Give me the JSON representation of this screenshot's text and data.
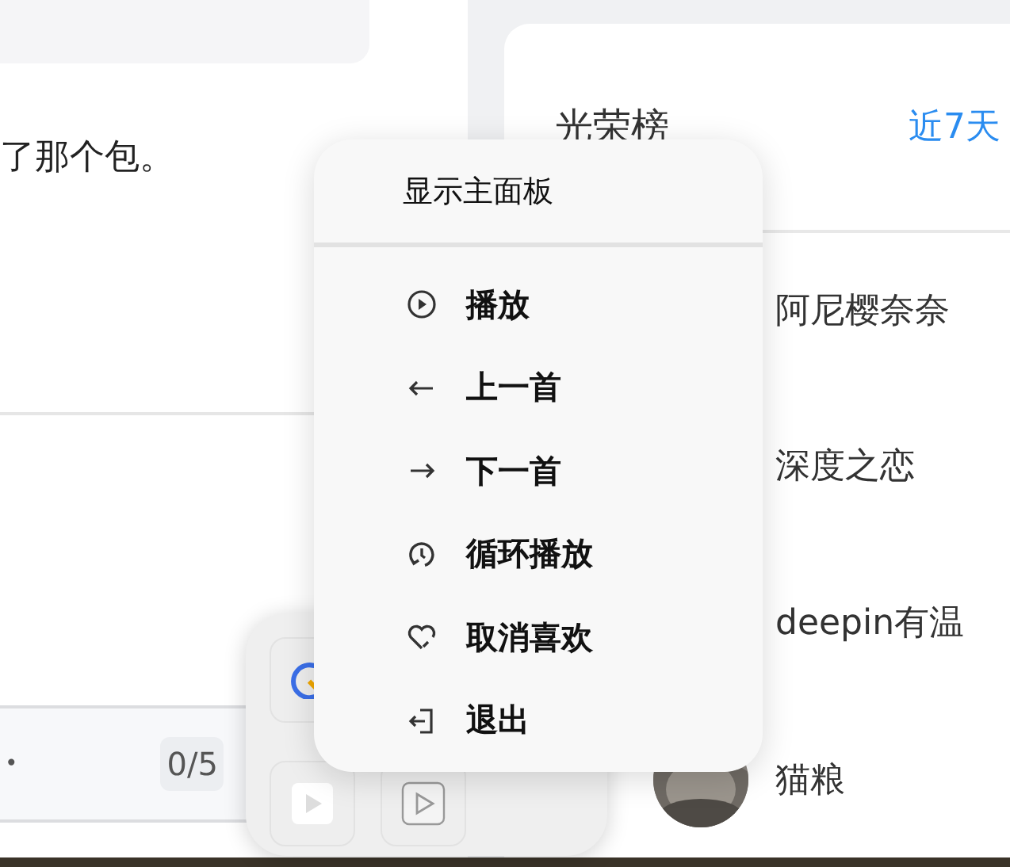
{
  "chat": {
    "message": "了那个包。",
    "input": {
      "dot": "•",
      "counter": "0/5"
    }
  },
  "leaderboard": {
    "title": "光荣榜",
    "range": "近7天",
    "entries": [
      {
        "name": "阿尼樱奈奈"
      },
      {
        "name": "深度之恋"
      },
      {
        "name": "deepin有温"
      },
      {
        "name": "猫粮"
      }
    ]
  },
  "tray_menu": {
    "header": "显示主面板",
    "items": [
      {
        "label": "播放",
        "kind": "play"
      },
      {
        "label": "上一首",
        "kind": "prev"
      },
      {
        "label": "下一首",
        "kind": "next"
      },
      {
        "label": "循环播放",
        "kind": "loop"
      },
      {
        "label": "取消喜欢",
        "kind": "unlike"
      },
      {
        "label": "退出",
        "kind": "exit"
      }
    ]
  },
  "tray_popup": {
    "apps": [
      {
        "kind": "clock"
      },
      {
        "kind": "play"
      },
      {
        "kind": "play-outline"
      }
    ]
  }
}
